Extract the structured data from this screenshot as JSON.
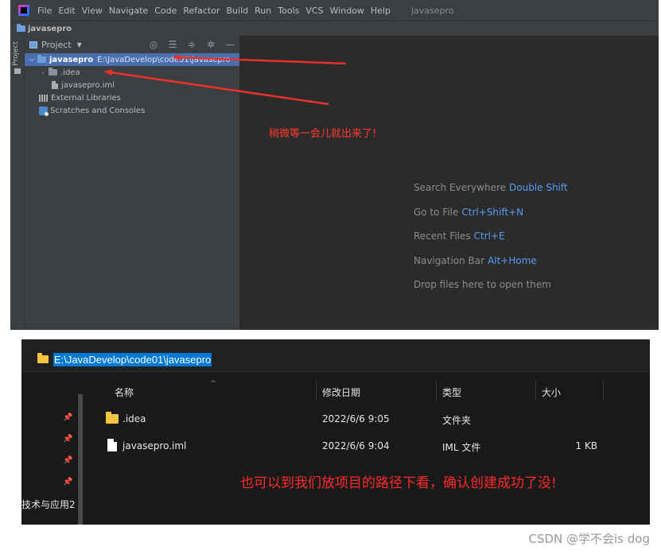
{
  "ide": {
    "menu": [
      "File",
      "Edit",
      "View",
      "Navigate",
      "Code",
      "Refactor",
      "Build",
      "Run",
      "Tools",
      "VCS",
      "Window",
      "Help"
    ],
    "window_title": "javasepro",
    "breadcrumb": "javasepro",
    "side_stripe_label": "Project",
    "panel_title": "Project",
    "tree": {
      "root_name": "javasepro",
      "root_path": "E:\\JavaDevelop\\code01\\javasepro",
      "idea": ".idea",
      "iml": "javasepro.iml",
      "external_libraries": "External Libraries",
      "scratches": "Scratches and Consoles"
    },
    "hints": [
      {
        "label": "Search Everywhere",
        "key": "Double Shift"
      },
      {
        "label": "Go to File",
        "key": "Ctrl+Shift+N"
      },
      {
        "label": "Recent Files",
        "key": "Ctrl+E"
      },
      {
        "label": "Navigation Bar",
        "key": "Alt+Home"
      },
      {
        "label": "Drop files here to open them",
        "key": ""
      }
    ],
    "annotation": "稍微等一会儿就出来了!",
    "annotation_color": "#ff3b30"
  },
  "explorer": {
    "address": "E:\\JavaDevelop\\code01\\javasepro",
    "columns": {
      "name": "名称",
      "modified": "修改日期",
      "type": "类型",
      "size": "大小"
    },
    "rows": [
      {
        "name": ".idea",
        "modified": "2022/6/6 9:05",
        "type": "文件夹",
        "size": ""
      },
      {
        "name": "javasepro.iml",
        "modified": "2022/6/6 9:04",
        "type": "IML 文件",
        "size": "1 KB"
      }
    ],
    "nav_label": "技术与应用2",
    "annotation": "也可以到我们放项目的路径下看，确认创建成功了没!",
    "annotation_color": "#ff2a2a"
  },
  "watermark": "CSDN @学不会is dog"
}
